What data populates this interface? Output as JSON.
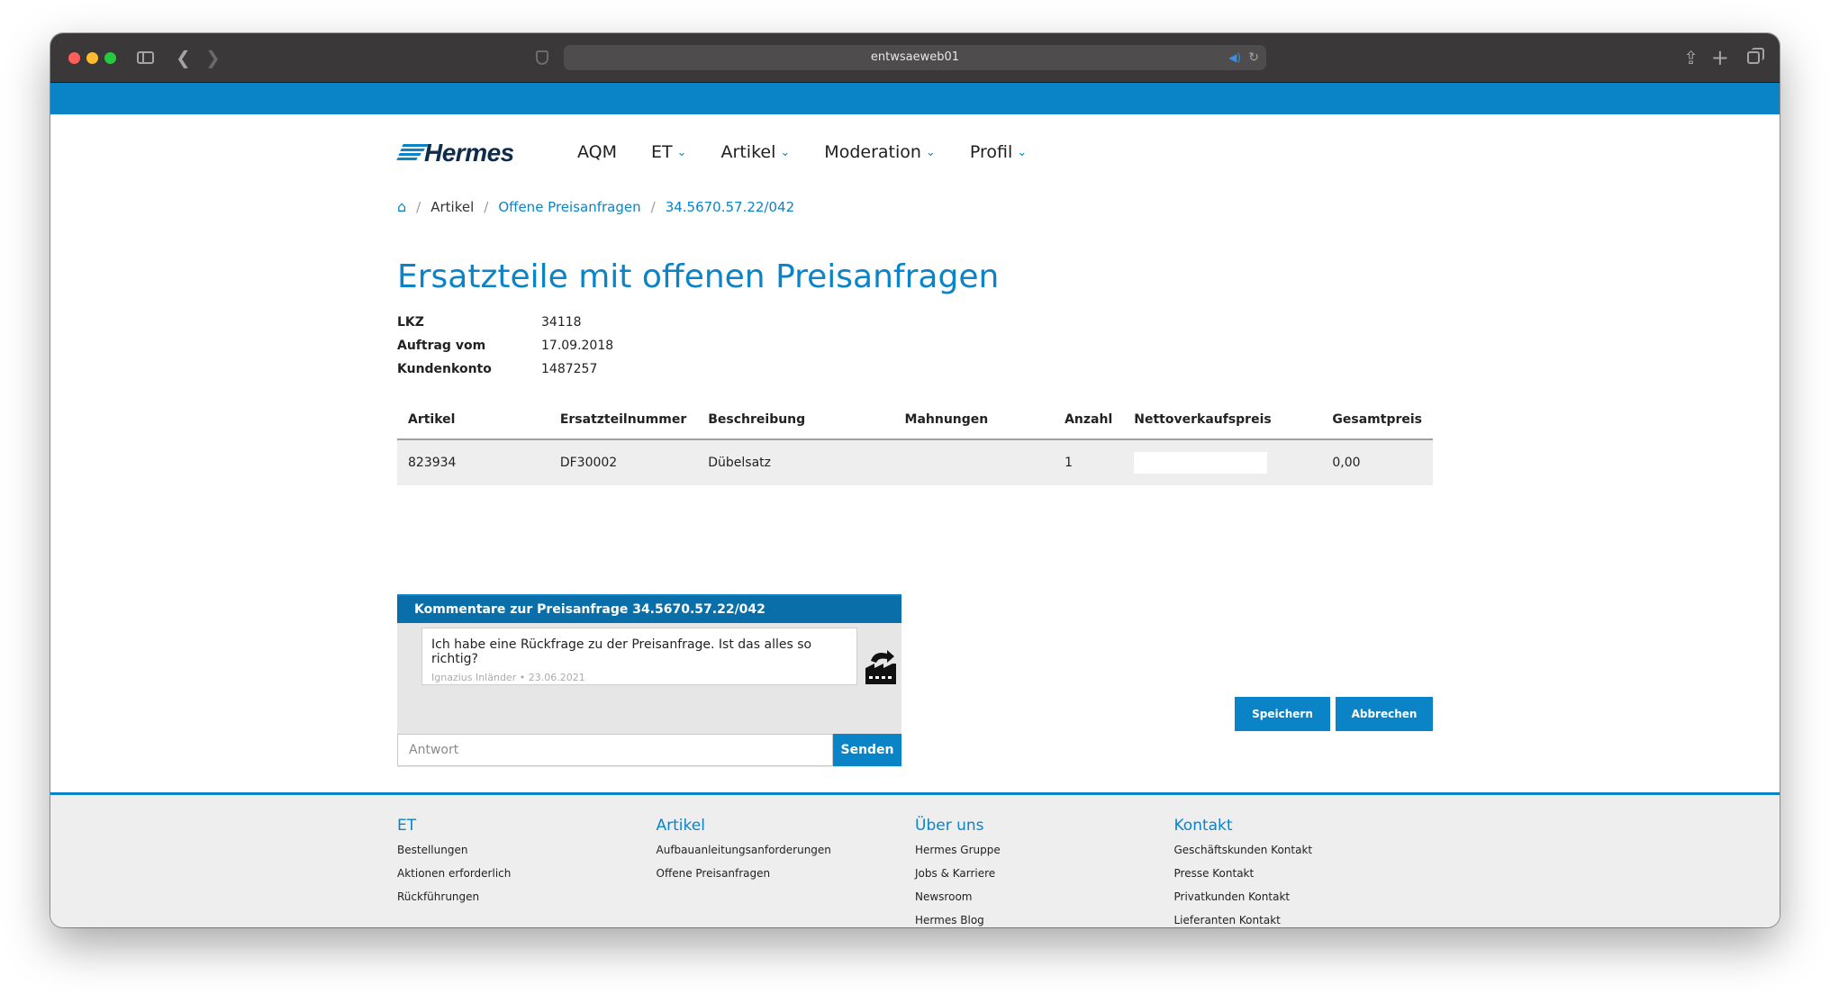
{
  "browser": {
    "url": "entwsaeweb01"
  },
  "brand": {
    "logo_text": "Hermes",
    "accent": "#0a84c6"
  },
  "nav": {
    "items": [
      {
        "label": "AQM"
      },
      {
        "label": "ET"
      },
      {
        "label": "Artikel"
      },
      {
        "label": "Moderation"
      },
      {
        "label": "Profil"
      }
    ]
  },
  "breadcrumb": {
    "items": [
      "Artikel",
      "Offene Preisanfragen",
      "34.5670.57.22/042"
    ]
  },
  "page_title": "Ersatzteile mit offenen Preisanfragen",
  "meta": [
    {
      "label": "LKZ",
      "value": "34118"
    },
    {
      "label": "Auftrag vom",
      "value": "17.09.2018"
    },
    {
      "label": "Kundenkonto",
      "value": "1487257"
    }
  ],
  "table": {
    "headers": [
      "Artikel",
      "Ersatzteilnummer",
      "Beschreibung",
      "Mahnungen",
      "Anzahl",
      "Nettoverkaufspreis",
      "Gesamtpreis"
    ],
    "rows": [
      {
        "artikel": "823934",
        "ersatzteilnummer": "DF30002",
        "beschreibung": "Dübelsatz",
        "mahnungen": "",
        "anzahl": "1",
        "nettoverkaufspreis": "",
        "gesamtpreis": "0,00"
      }
    ]
  },
  "comments": {
    "header": "Kommentare zur Preisanfrage 34.5670.57.22/042",
    "items": [
      {
        "text": "Ich habe eine Rückfrage zu der Preisanfrage. Ist das alles so richtig?",
        "author_date": "Ignazius Inländer • 23.06.2021",
        "icon": "factory-icon"
      }
    ],
    "reply_placeholder": "Antwort",
    "send_label": "Senden"
  },
  "actions": {
    "save_label": "Speichern",
    "cancel_label": "Abbrechen"
  },
  "footer": {
    "columns": [
      {
        "title": "ET",
        "links": [
          "Bestellungen",
          "Aktionen erforderlich",
          "Rückführungen"
        ]
      },
      {
        "title": "Artikel",
        "links": [
          "Aufbauanleitungsanforderungen",
          "Offene Preisanfragen"
        ]
      },
      {
        "title": "Über uns",
        "links": [
          "Hermes Gruppe",
          "Jobs & Karriere",
          "Newsroom",
          "Hermes Blog"
        ]
      },
      {
        "title": "Kontakt",
        "links": [
          "Geschäftskunden Kontakt",
          "Presse Kontakt",
          "Privatkunden Kontakt",
          "Lieferanten Kontakt"
        ]
      }
    ]
  }
}
